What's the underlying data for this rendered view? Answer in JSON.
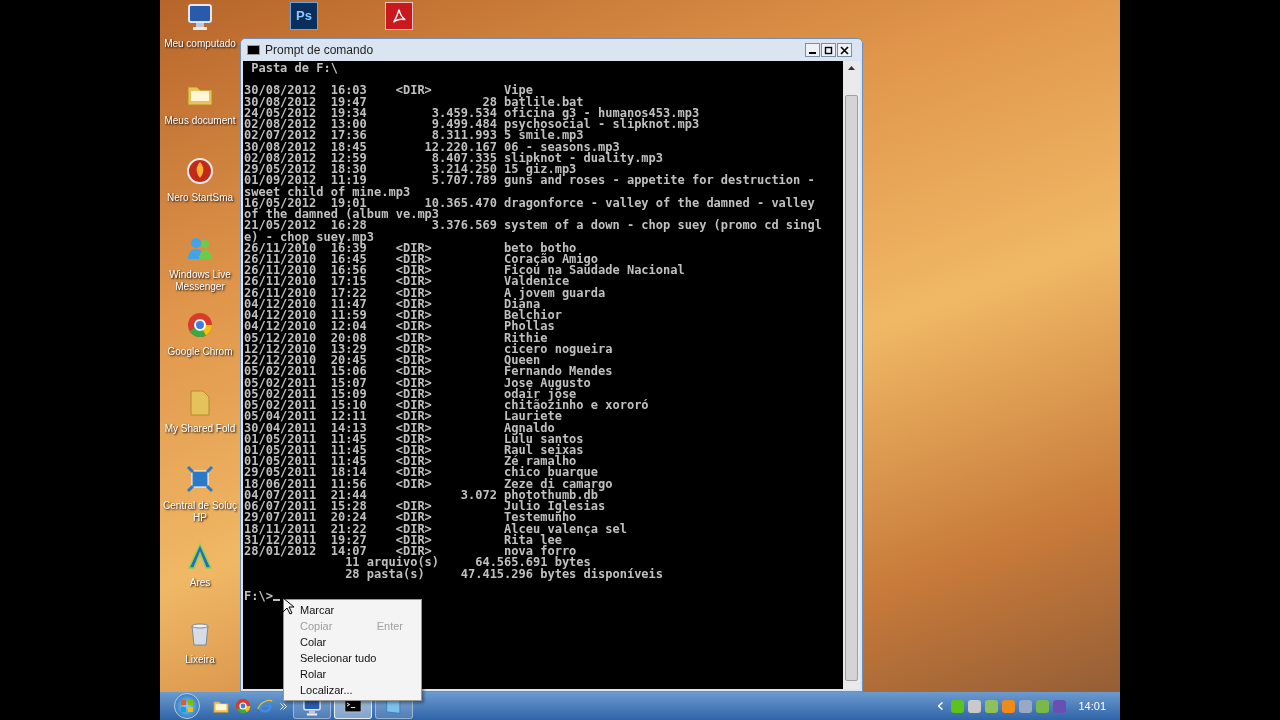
{
  "desktop": {
    "top_icons": [
      {
        "kind": "photoshop",
        "glyph": "Ps"
      },
      {
        "kind": "acrobat"
      }
    ],
    "icons": [
      {
        "kind": "computer",
        "label": "Meu computado"
      },
      {
        "kind": "folder",
        "label": "Meus document"
      },
      {
        "kind": "nero",
        "label": "Nero StartSma"
      },
      {
        "kind": "messenger",
        "label": "Windows Live Messenger"
      },
      {
        "kind": "chrome",
        "label": "Google Chrom"
      },
      {
        "kind": "shared",
        "label": "My Shared Fold"
      },
      {
        "kind": "hp",
        "label": "Central de Soluç HP"
      },
      {
        "kind": "ares",
        "label": "Ares"
      },
      {
        "kind": "bin",
        "label": "Lixeira"
      }
    ]
  },
  "window": {
    "title": "Prompt de comando",
    "console": {
      "header": " Pasta de F:\\",
      "entries": [
        "30/08/2012  16:03    <DIR>          Vipe",
        "30/08/2012  19:47                28 batlile.bat",
        "24/05/2012  19:34         3.459.534 oficina g3 - humanos453.mp3",
        "02/08/2012  13:00         9.499.484 psychosocial - slipknot.mp3",
        "02/07/2012  17:36         8.311.993 5 smile.mp3",
        "30/08/2012  18:45        12.220.167 06 - seasons.mp3",
        "02/08/2012  12:59         8.407.335 slipknot - duality.mp3",
        "29/05/2012  18:30         3.214.250 15 giz.mp3",
        "01/09/2012  11:19         5.707.789 guns and roses - appetite for destruction -",
        "sweet child of mine.mp3",
        "16/05/2012  19:01        10.365.470 dragonforce - valley of the damned - valley",
        "of the damned (album ve.mp3",
        "21/05/2012  16:28         3.376.569 system of a down - chop suey (promo cd singl",
        "e) - chop suey.mp3",
        "26/11/2010  16:39    <DIR>          beto botho",
        "26/11/2010  16:45    <DIR>          Coração Amigo",
        "26/11/2010  16:56    <DIR>          Ficou na Saudade Nacional",
        "26/11/2010  17:15    <DIR>          Valdenice",
        "26/11/2010  17:22    <DIR>          A jovem guarda",
        "04/12/2010  11:47    <DIR>          Diana",
        "04/12/2010  11:59    <DIR>          Belchior",
        "04/12/2010  12:04    <DIR>          Phollas",
        "05/12/2010  20:08    <DIR>          Rithie",
        "12/12/2010  13:29    <DIR>          cicero nogueira",
        "22/12/2010  20:45    <DIR>          Queen",
        "05/02/2011  15:06    <DIR>          Fernando Mendes",
        "05/02/2011  15:07    <DIR>          Jose Augusto",
        "05/02/2011  15:09    <DIR>          odair jose",
        "05/02/2011  15:10    <DIR>          chitãozinho e xororó",
        "05/04/2011  12:11    <DIR>          Lauriete",
        "30/04/2011  14:13    <DIR>          Agnaldo",
        "01/05/2011  11:45    <DIR>          Lulu santos",
        "01/05/2011  11:45    <DIR>          Raul seixas",
        "01/05/2011  11:45    <DIR>          Zé ramalho",
        "29/05/2011  18:14    <DIR>          chico buarque",
        "18/06/2011  11:56    <DIR>          Zeze di camargo",
        "04/07/2011  21:44             3.072 photothumb.db",
        "06/07/2011  15:28    <DIR>          Julio Iglesias",
        "29/07/2011  20:24    <DIR>          Testemunho",
        "18/11/2011  21:22    <DIR>          Alceu valença sel",
        "31/12/2011  19:27    <DIR>          Rita lee",
        "28/01/2012  14:07    <DIR>          nova forro"
      ],
      "summary": [
        "              11 arquivo(s)     64.565.691 bytes",
        "              28 pasta(s)     47.415.296 bytes disponíveis"
      ],
      "prompt": "F:\\>"
    },
    "context_menu": [
      {
        "label": "Marcar",
        "disabled": false
      },
      {
        "label": "Copiar",
        "disabled": true,
        "shortcut": "Enter"
      },
      {
        "label": "Colar",
        "disabled": false
      },
      {
        "label": "Selecionar tudo",
        "disabled": false
      },
      {
        "label": "Rolar",
        "disabled": false
      },
      {
        "label": "Localizar...",
        "disabled": false
      }
    ]
  },
  "taskbar": {
    "quick_launch": [
      {
        "kind": "folder"
      },
      {
        "kind": "chrome"
      },
      {
        "kind": "ie"
      }
    ],
    "tasks": [
      {
        "kind": "computer",
        "selected": false
      },
      {
        "kind": "console",
        "selected": true
      },
      {
        "kind": "window",
        "selected": false
      }
    ],
    "clock": "14:01"
  }
}
